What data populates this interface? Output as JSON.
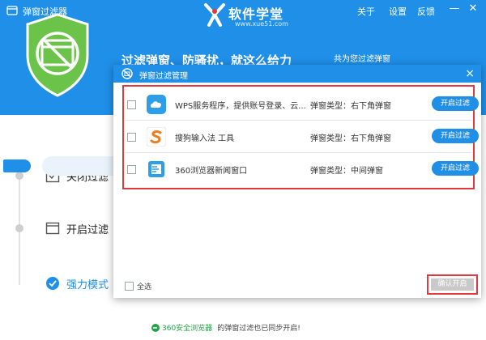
{
  "colors": {
    "accent": "#1f8fe8",
    "highlight": "#e0383c",
    "shield": "#6cc34a",
    "link": "#27a14a"
  },
  "app": {
    "title": "弹窗过滤器"
  },
  "brand": {
    "name": "软件学堂",
    "url": "www.xue51.com"
  },
  "top_links": {
    "about": "关于",
    "settings": "设置",
    "feedback": "反馈"
  },
  "window_controls": {
    "minimize": "—",
    "close": "✕"
  },
  "banner": {
    "slogan": "过滤弹窗、防骚扰，就这么给力",
    "note": "共为您过滤弹窗"
  },
  "modes": [
    {
      "label": "关闭过滤",
      "icon": "checkbox-icon"
    },
    {
      "label": "开启过滤",
      "icon": "window-icon"
    },
    {
      "label": "强力模式",
      "icon": "check-circle-icon",
      "active": true
    }
  ],
  "footer": {
    "link": "360安全浏览器",
    "text": "的弹窗过滤也已同步开启!"
  },
  "dialog": {
    "title": "弹窗过滤管理",
    "close": "×",
    "rows": [
      {
        "name": "WPS服务程序，提供账号登录、云...",
        "type": "弹窗类型：右下角弹窗",
        "button": "开启过滤",
        "icon": "cloud-icon"
      },
      {
        "name": "搜狗输入法 工具",
        "type": "弹窗类型：右下角弹窗",
        "button": "开启过滤",
        "icon": "sogou-icon"
      },
      {
        "name": "360浏览器新闻窗口",
        "type": "弹窗类型：中间弹窗",
        "button": "开启过滤",
        "icon": "browser-icon"
      }
    ],
    "select_all": "全选",
    "confirm": "确认开启"
  }
}
